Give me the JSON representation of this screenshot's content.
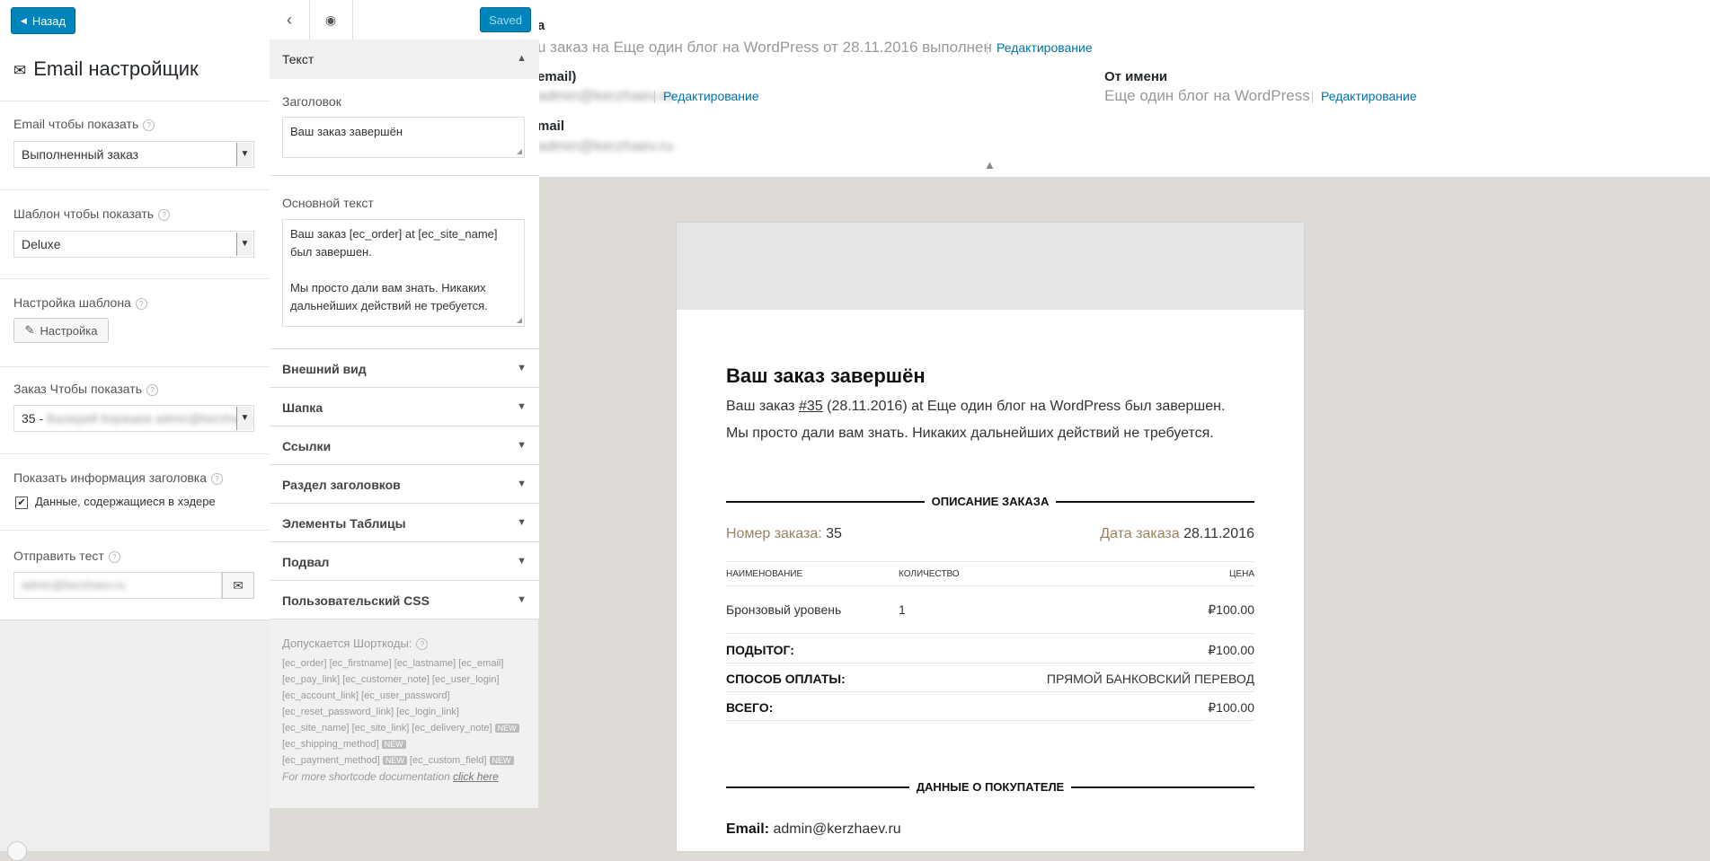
{
  "email_info": {
    "subject_label_partial": "а",
    "subject_value": "u заказ на Еще один блог на WordPress от 28.11.2016 выполнен",
    "subject_edit": "Редактирование",
    "from_email_label_partial": "email)",
    "from_email_value": "admin@kerzhaev.ru",
    "from_email_edit": "Редактирование",
    "from_name_label": "От имени",
    "from_name_value": "Еще один блог на WordPress",
    "from_name_edit": "Редактирование",
    "recipient_label_partial": "mail",
    "recipient_value": "admin@kerzhaev.ru"
  },
  "left_panel": {
    "back_label": "Назад",
    "title": "Email настройщик",
    "email_select": {
      "label": "Email чтобы показать",
      "value": "Выполненный заказ"
    },
    "template_select": {
      "label": "Шаблон чтобы показать",
      "value": "Deluxe"
    },
    "template_settings": {
      "label": "Настройка шаблона",
      "button": "Настройка"
    },
    "order_select": {
      "label": "Заказ Чтобы показать",
      "value_prefix": "35 -",
      "value_blurred": "Валерий Кержаев admin@kerzhaev.ru"
    },
    "header_info": {
      "label": "Показать информация заголовка",
      "checkbox_label": "Данные, содержащиеся в хэдере",
      "checked": true
    },
    "send_test": {
      "label": "Отправить тест",
      "value": "admin@kerzhaev.ru"
    }
  },
  "editor_panel": {
    "saved_label": "Saved",
    "text_section": "Текст",
    "heading_label": "Заголовок",
    "heading_value": "Ваш заказ завершён",
    "body_label": "Основной текст",
    "body_lines": [
      "Ваш заказ [ec_order] at [ec_site_name]",
      "был завершен.",
      "",
      "Мы просто дали вам знать. Никаких",
      "дальнейших действий не требуется."
    ],
    "sections": [
      "Внешний вид",
      "Шапка",
      "Ссылки",
      "Раздел заголовков",
      "Элементы Таблицы",
      "Подвал",
      "Пользовательский CSS"
    ],
    "shortcodes_title": "Допускается Шорткоды:",
    "shortcode_lines": [
      {
        "text": "[ec_order] [ec_firstname] [ec_lastname] [ec_email]",
        "new": false
      },
      {
        "text": "[ec_pay_link] [ec_customer_note] [ec_user_login]",
        "new": false
      },
      {
        "text": "[ec_account_link] [ec_user_password]",
        "new": false
      },
      {
        "text": "[ec_reset_password_link] [ec_login_link]",
        "new": false
      },
      {
        "text": "[ec_site_name] [ec_site_link] [ec_delivery_note]",
        "new": true
      },
      {
        "text": "[ec_shipping_method]",
        "new": true
      },
      {
        "text": "[ec_payment_method]",
        "new": true,
        "extra": "[ec_custom_field]"
      }
    ],
    "new_badge": "NEW",
    "doc_prefix": "For more shortcode documentation",
    "doc_link": "click here"
  },
  "email_preview": {
    "title": "Ваш заказ завершён",
    "line1_prefix": "Ваш заказ",
    "line1_order": "#35",
    "line1_suffix": "(28.11.2016) at Еще один блог на WordPress был завершен.",
    "line2": "Мы просто дали вам знать. Никаких дальнейших действий не требуется.",
    "order_section_title": "ОПИСАНИЕ ЗАКАЗА",
    "order_no_label": "Номер заказа:",
    "order_no_value": "35",
    "order_date_label": "Дата заказа",
    "order_date_value": "28.11.2016",
    "table_headers": [
      "НАИМЕНОВАНИЕ",
      "КОЛИЧЕСТВО",
      "ЦЕНА"
    ],
    "item": {
      "name": "Бронзовый уровень",
      "qty": "1",
      "price": "₽100.00"
    },
    "subtotal_label": "ПОДЫТОГ:",
    "subtotal_value": "₽100.00",
    "payment_label": "СПОСОБ ОПЛАТЫ:",
    "payment_value": "ПРЯМОЙ БАНКОВСКИЙ ПЕРЕВОД",
    "total_label": "ВСЕГО:",
    "total_value": "₽100.00",
    "customer_section_title": "ДАННЫЕ О ПОКУПАТЕЛЕ",
    "customer_email_label": "Email:",
    "customer_email_value": "admin@kerzhaev.ru"
  },
  "colors": {
    "accent": "#0085ba",
    "link": "#0073aa",
    "label_gold": "#9a8461"
  }
}
